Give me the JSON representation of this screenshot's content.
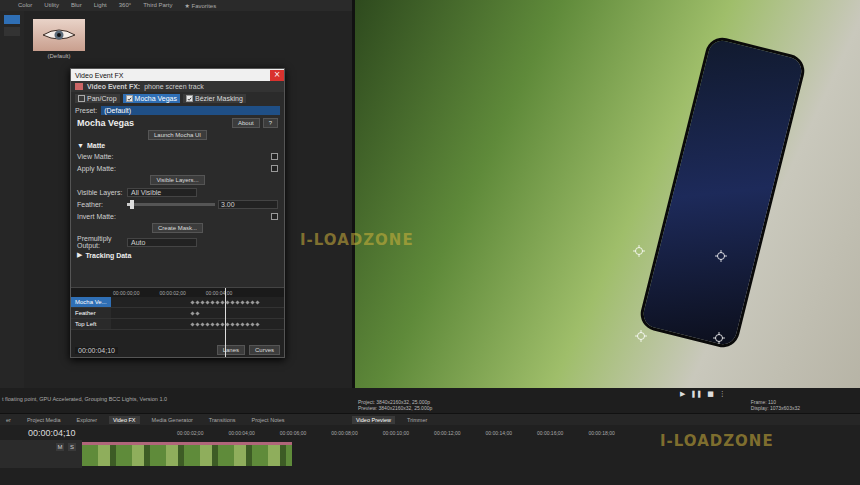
{
  "fx_browser": {
    "tabs": [
      {
        "label": "Color",
        "selected": false
      },
      {
        "label": "Utility",
        "selected": false
      },
      {
        "label": "Blur",
        "selected": false
      },
      {
        "label": "Light",
        "selected": false
      },
      {
        "label": "360°",
        "selected": false
      },
      {
        "label": "Third Party",
        "selected": false
      },
      {
        "label": "★ Favorites",
        "selected": false
      }
    ],
    "preset_label": "(Default)"
  },
  "dialog": {
    "title": "Video Event FX",
    "close": "×",
    "subtitle_label": "Video Event FX:",
    "subtitle": "phone screen track",
    "chain": [
      {
        "label": "Pan/Crop",
        "kind": "builtin",
        "checked": false,
        "selected": false
      },
      {
        "label": "Mocha Vegas",
        "kind": "plugin",
        "checked": true,
        "selected": true
      },
      {
        "label": "Bézier Masking",
        "kind": "plugin",
        "checked": true,
        "selected": false
      }
    ],
    "preset_label": "Preset:",
    "preset_value": "(Default)",
    "plugin_name": "Mocha Vegas",
    "about": "About",
    "help": "?",
    "launch": "Launch Mocha UI",
    "matte_section": {
      "label": "Matte",
      "arrow": "▼",
      "expanded": true
    },
    "rows": [
      {
        "kind": "checkbox",
        "label": "View Matte:",
        "checked": false
      },
      {
        "kind": "checkbox",
        "label": "Apply Matte:",
        "checked": false
      },
      {
        "kind": "button",
        "label": "Visible Layers..."
      },
      {
        "kind": "select",
        "label": "Visible Layers:",
        "value": "All Visible"
      },
      {
        "kind": "slider",
        "label": "Feather:",
        "value": "3.00",
        "level": 0.06
      },
      {
        "kind": "checkbox",
        "label": "Invert Matte:",
        "checked": false
      },
      {
        "kind": "button",
        "label": "Create Mask..."
      },
      {
        "kind": "select",
        "label": "Premultiply Output:",
        "value": "Auto"
      }
    ],
    "tracking_section": {
      "label": "Tracking Data",
      "arrow": "▶",
      "expanded": false
    },
    "keyframes": {
      "ruler": [
        "00:00:00;00",
        "00:00:02;00",
        "00:00:04;00"
      ],
      "tracks": [
        {
          "label": "Mocha Ve...",
          "selected": true
        },
        {
          "label": "Feather",
          "selected": false
        },
        {
          "label": "Top Left",
          "selected": false
        }
      ],
      "time": "00:00:04;10",
      "buttons": [
        "Lanes",
        "Curves"
      ],
      "playhead": 0.66
    }
  },
  "preview": {
    "transport": [
      "▶",
      "❚❚",
      "■",
      "⋮"
    ],
    "project": "Project: 3840x2160x32, 25.000p",
    "preview": "Preview: 3840x2160x32, 25.000p",
    "frame_label": "Frame:",
    "frame": "110",
    "display_label": "Display:",
    "display": "1073x603x32"
  },
  "status_bar": "t floating point, GPU Accelerated, Grouping BCC Lights, Version 1.0",
  "dock_tabs": [
    {
      "label": "er",
      "selected": false
    },
    {
      "label": "Project Media",
      "selected": false
    },
    {
      "label": "Explorer",
      "selected": false
    },
    {
      "label": "Video FX",
      "selected": true
    },
    {
      "label": "Media Generator",
      "selected": false
    },
    {
      "label": "Transitions",
      "selected": false
    },
    {
      "label": "Project Notes",
      "selected": false
    }
  ],
  "preview_tabs": [
    {
      "label": "Video Preview",
      "selected": true
    },
    {
      "label": "Trimmer",
      "selected": false
    }
  ],
  "timeline": {
    "time": "00:00:04;10",
    "mute": "M",
    "solo": "S",
    "ruler": [
      "00:00:02;00",
      "00:00:04;00",
      "00:00:06;00",
      "00:00:08;00",
      "00:00:10;00",
      "00:00:12;00",
      "00:00:14;00",
      "00:00:16;00",
      "00:00:18;00"
    ]
  },
  "watermarks": [
    "I-LOADZONE",
    "I-LOADZONE"
  ]
}
